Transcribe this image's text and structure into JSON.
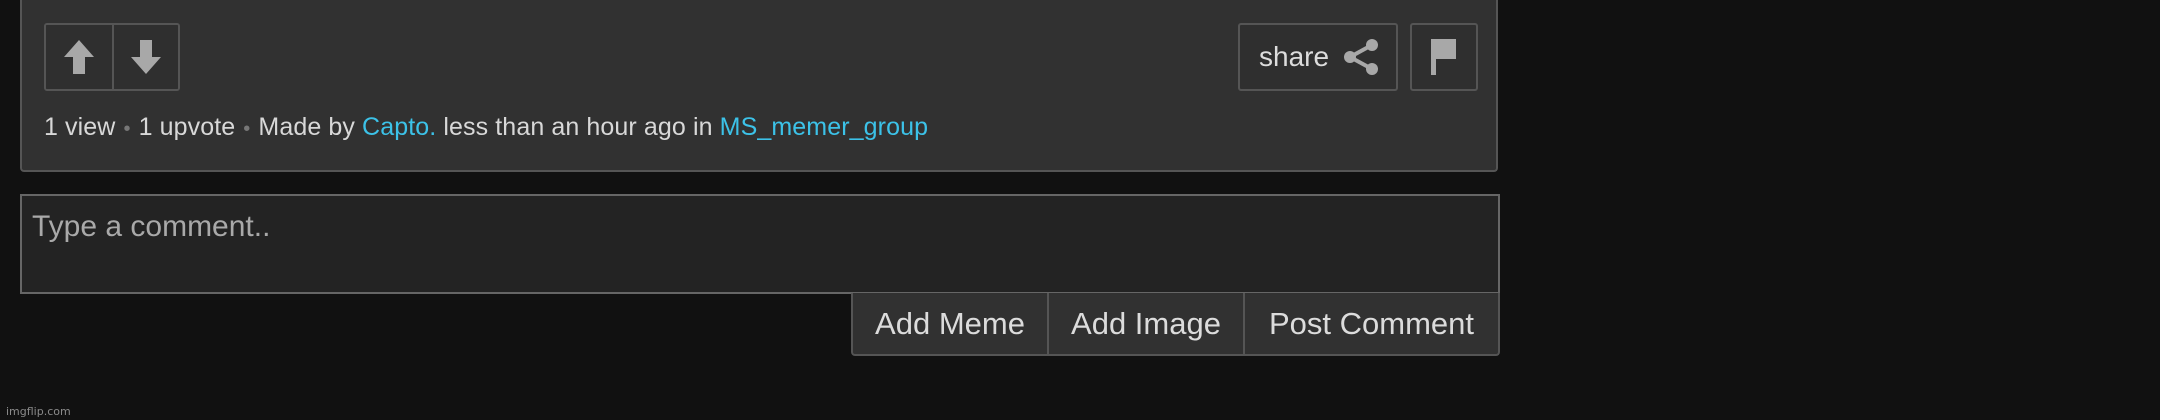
{
  "post": {
    "views": "1 view",
    "upvotes": "1 upvote",
    "made_by_prefix": "Made by",
    "author": "Capto.",
    "time_prefix": "less than an hour ago in",
    "group": "MS_memer_group",
    "separator": "•"
  },
  "actions": {
    "upvote_icon": "arrow-up-icon",
    "downvote_icon": "arrow-down-icon",
    "share_label": "share",
    "share_icon": "share-icon",
    "flag_icon": "flag-icon"
  },
  "comment": {
    "placeholder": "Type a comment..",
    "value": ""
  },
  "comment_actions": {
    "add_meme": "Add Meme",
    "add_image": "Add Image",
    "post_comment": "Post Comment"
  },
  "watermark": "imgflip.com",
  "colors": {
    "background": "#111111",
    "panel": "#313131",
    "border": "#555555",
    "link": "#3cc2e8",
    "text": "#d8d8d8"
  }
}
